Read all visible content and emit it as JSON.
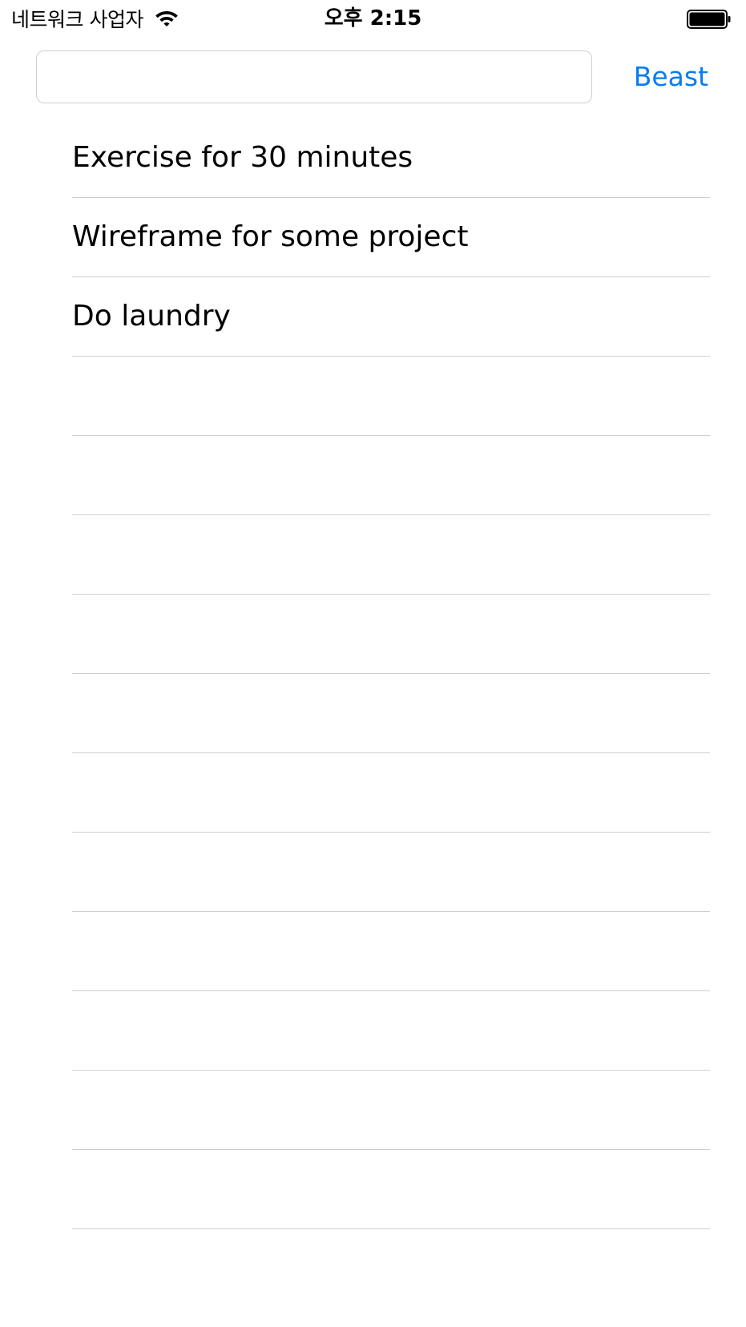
{
  "status_bar": {
    "carrier": "네트워크 사업자",
    "time": "오후 2:15",
    "wifi_icon": "wifi-icon",
    "battery_icon": "battery-full-icon"
  },
  "input": {
    "value": "",
    "placeholder": ""
  },
  "action_button": {
    "label": "Beast",
    "color": "#0a7cf0"
  },
  "tasks": [
    {
      "label": "Exercise for 30 minutes"
    },
    {
      "label": "Wireframe for some project"
    },
    {
      "label": "Do laundry"
    },
    {
      "label": ""
    },
    {
      "label": ""
    },
    {
      "label": ""
    },
    {
      "label": ""
    },
    {
      "label": ""
    },
    {
      "label": ""
    },
    {
      "label": ""
    },
    {
      "label": ""
    },
    {
      "label": ""
    },
    {
      "label": ""
    },
    {
      "label": ""
    }
  ]
}
